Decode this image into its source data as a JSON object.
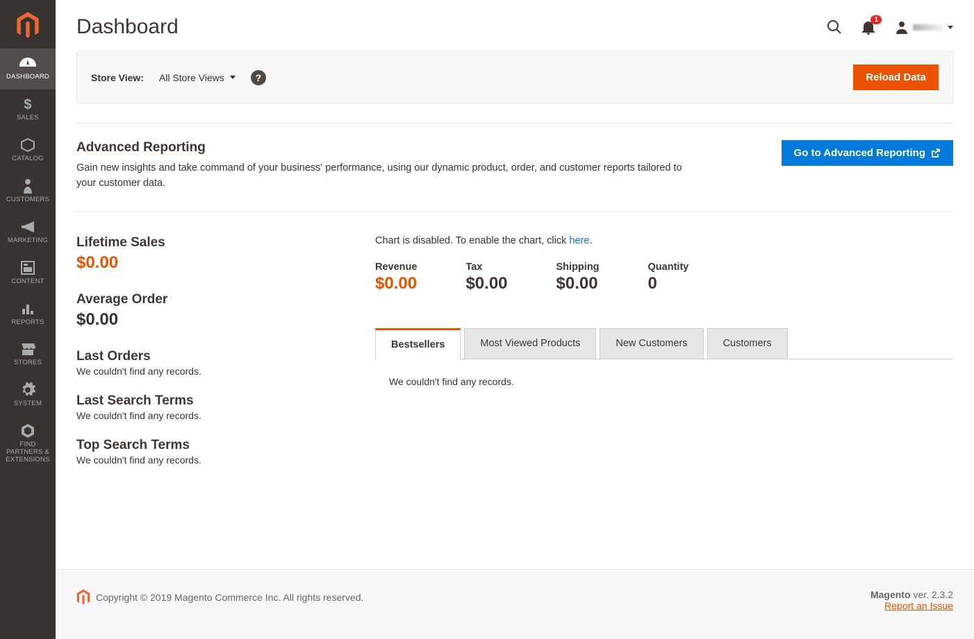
{
  "sidebar": {
    "items": [
      {
        "label": "DASHBOARD"
      },
      {
        "label": "SALES"
      },
      {
        "label": "CATALOG"
      },
      {
        "label": "CUSTOMERS"
      },
      {
        "label": "MARKETING"
      },
      {
        "label": "CONTENT"
      },
      {
        "label": "REPORTS"
      },
      {
        "label": "STORES"
      },
      {
        "label": "SYSTEM"
      },
      {
        "label": "FIND PARTNERS & EXTENSIONS"
      }
    ]
  },
  "header": {
    "title": "Dashboard",
    "notification_count": "1"
  },
  "storebar": {
    "label": "Store View:",
    "selected": "All Store Views",
    "help": "?",
    "reload_btn": "Reload Data"
  },
  "adv": {
    "title": "Advanced Reporting",
    "desc": "Gain new insights and take command of your business' performance, using our dynamic product, order, and customer reports tailored to your customer data.",
    "btn": "Go to Advanced Reporting"
  },
  "stats": {
    "lifetime_label": "Lifetime Sales",
    "lifetime_value": "$0.00",
    "avg_label": "Average Order",
    "avg_value": "$0.00"
  },
  "lists": {
    "last_orders": {
      "title": "Last Orders",
      "empty": "We couldn't find any records."
    },
    "last_search": {
      "title": "Last Search Terms",
      "empty": "We couldn't find any records."
    },
    "top_search": {
      "title": "Top Search Terms",
      "empty": "We couldn't find any records."
    }
  },
  "chart": {
    "msg_pre": "Chart is disabled. To enable the chart, click ",
    "link": "here",
    "msg_post": "."
  },
  "metrics": {
    "revenue": {
      "label": "Revenue",
      "value": "$0.00"
    },
    "tax": {
      "label": "Tax",
      "value": "$0.00"
    },
    "shipping": {
      "label": "Shipping",
      "value": "$0.00"
    },
    "quantity": {
      "label": "Quantity",
      "value": "0"
    }
  },
  "tabs": {
    "bestsellers": "Bestsellers",
    "most_viewed": "Most Viewed Products",
    "new_customers": "New Customers",
    "customers": "Customers",
    "empty": "We couldn't find any records."
  },
  "footer": {
    "copyright": "Copyright © 2019 Magento Commerce Inc. All rights reserved.",
    "version_label": "Magento",
    "version": " ver. 2.3.2",
    "report": "Report an Issue"
  }
}
